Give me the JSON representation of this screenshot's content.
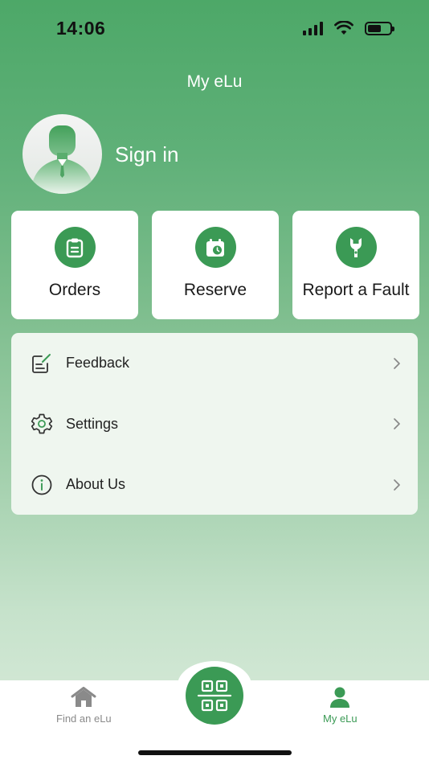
{
  "status_bar": {
    "time": "14:06"
  },
  "header": {
    "title": "My eLu"
  },
  "profile": {
    "sign_in_label": "Sign in"
  },
  "quick_actions": [
    {
      "label": "Orders",
      "icon": "clipboard-icon"
    },
    {
      "label": "Reserve",
      "icon": "calendar-clock-icon"
    },
    {
      "label": "Report a Fault",
      "icon": "wrench-icon"
    }
  ],
  "menu": [
    {
      "label": "Feedback",
      "icon": "feedback-edit-icon"
    },
    {
      "label": "Settings",
      "icon": "gear-icon"
    },
    {
      "label": "About Us",
      "icon": "info-icon"
    }
  ],
  "tabbar": {
    "find_label": "Find an eLu",
    "my_label": "My eLu",
    "active_tab": "my"
  },
  "colors": {
    "accent": "#3b9a55",
    "inactive_tab": "#8a8a8a",
    "active_tab": "#3b9a55"
  }
}
